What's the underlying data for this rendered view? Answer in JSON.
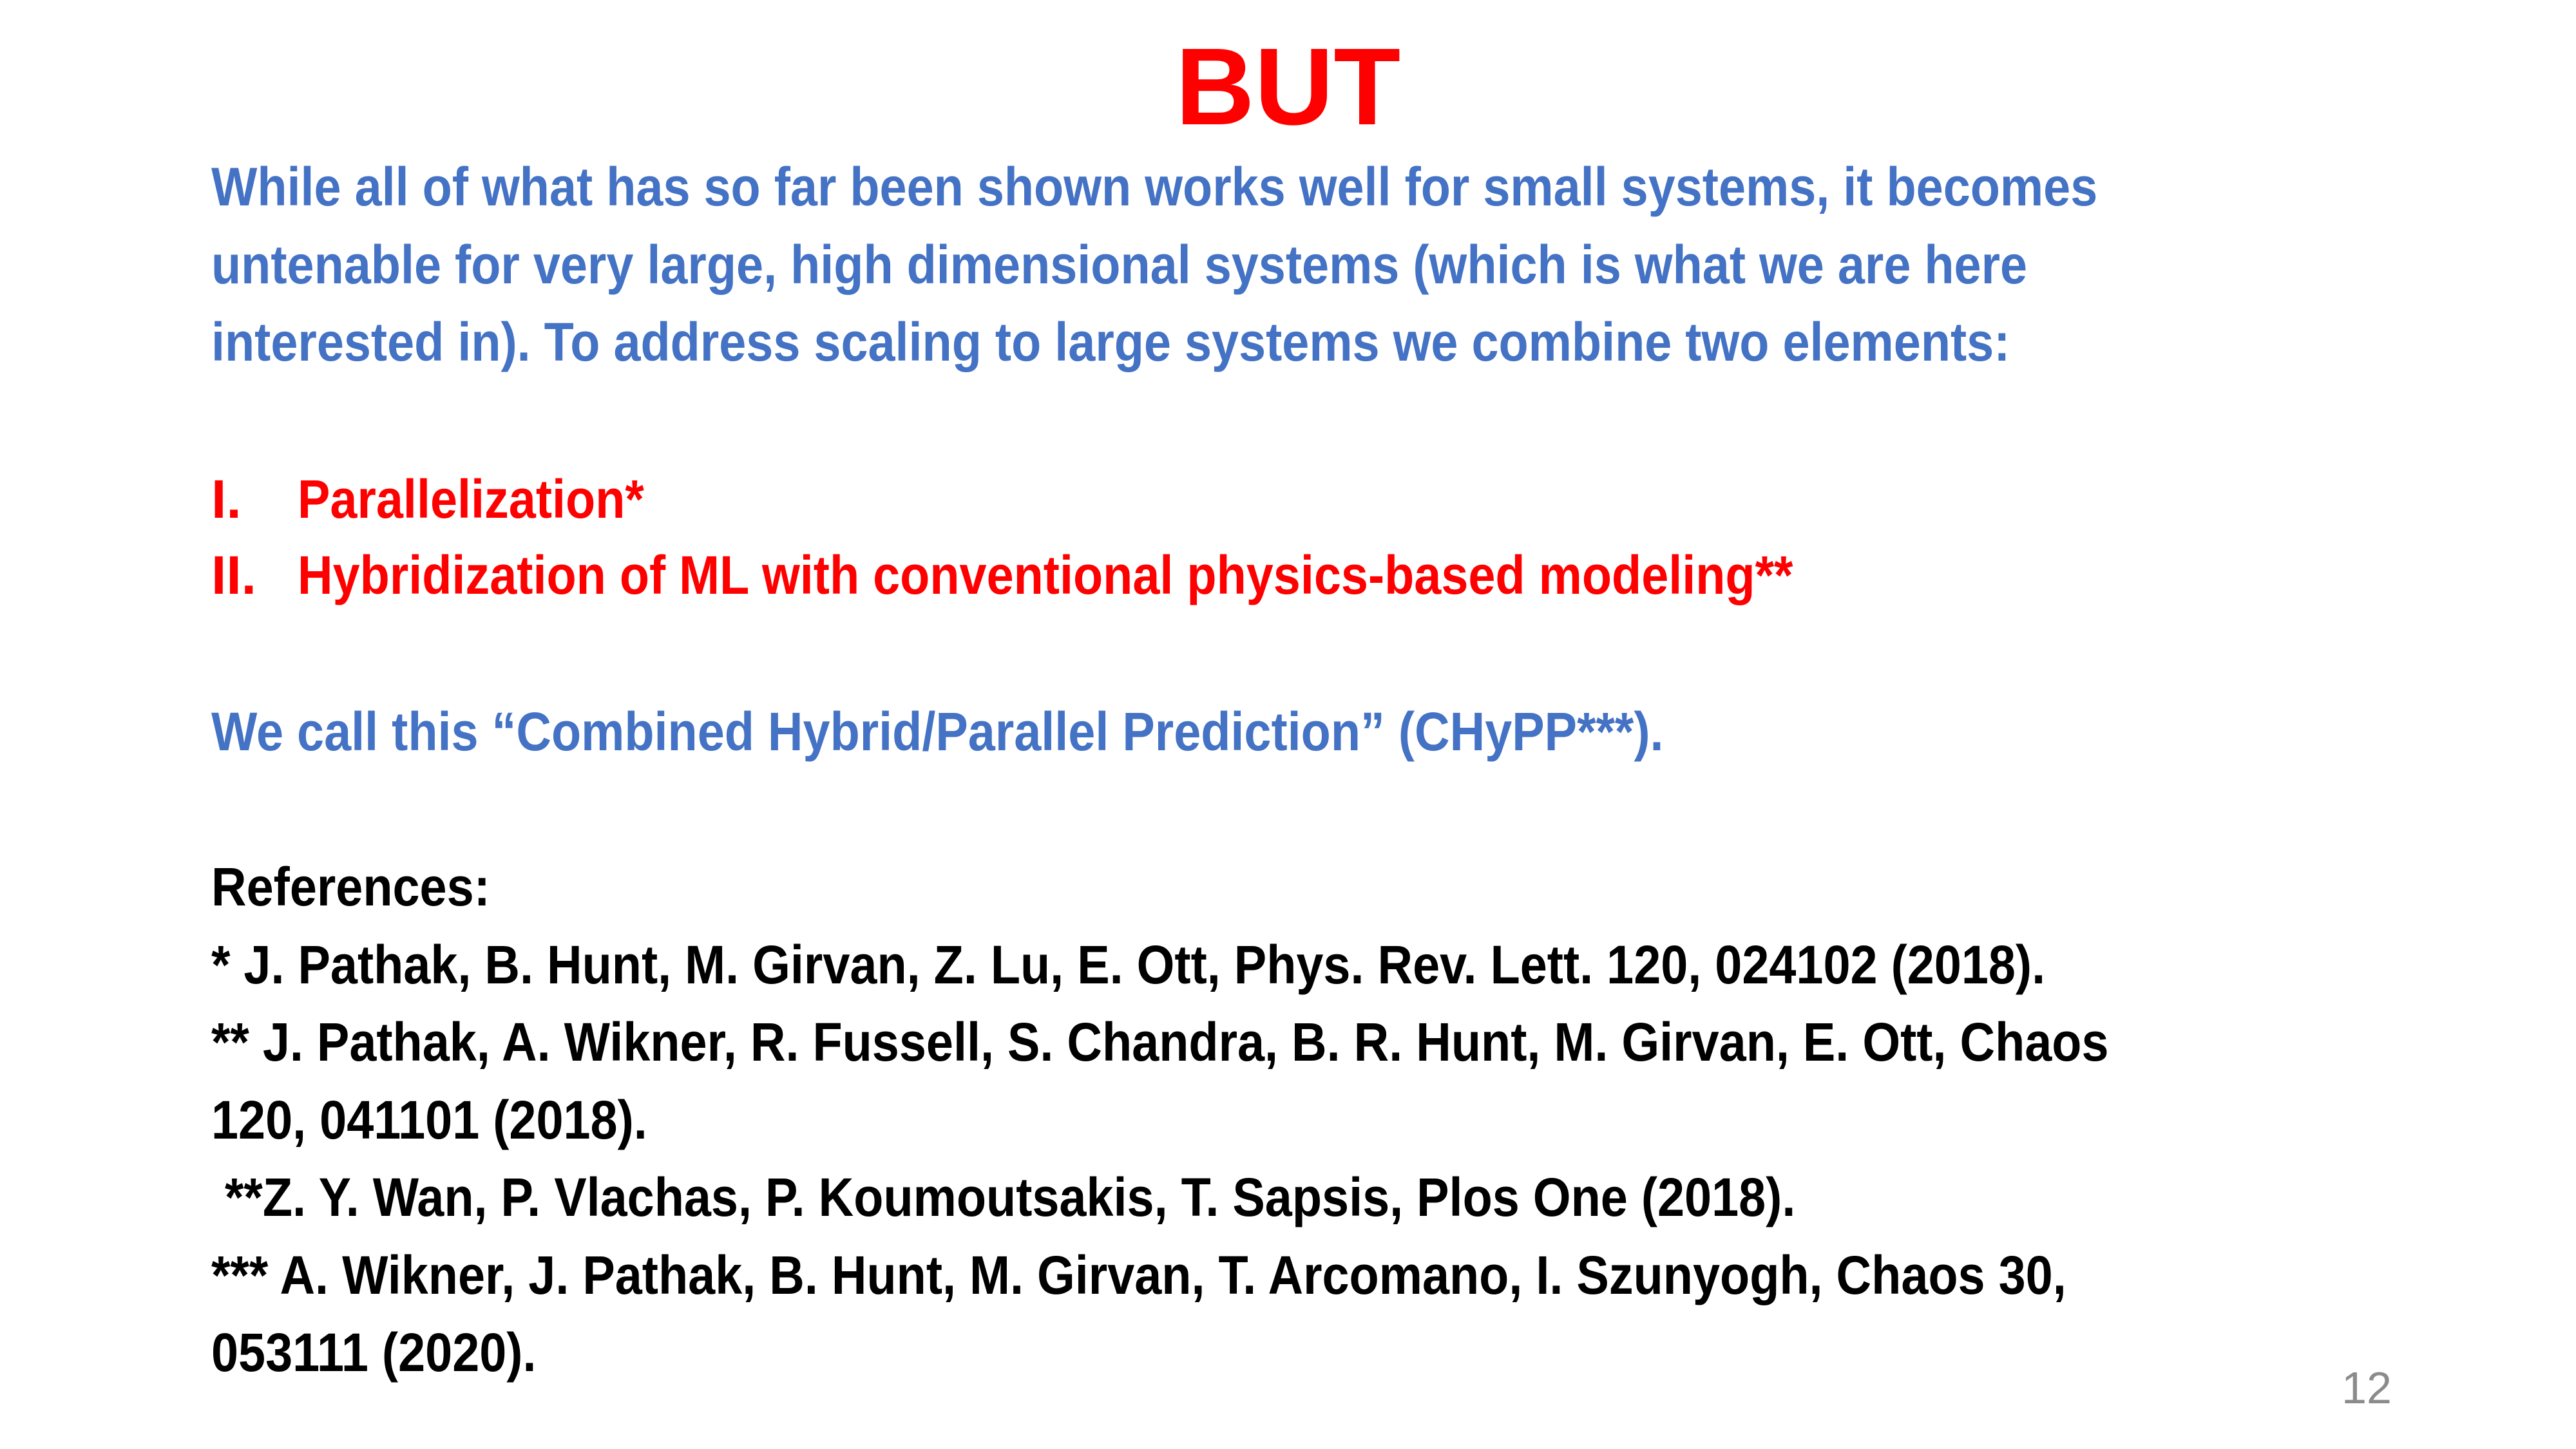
{
  "title": "BUT",
  "intro_lines": [
    "While all of what has so far been shown works well for small systems, it becomes",
    "untenable for very large, high dimensional systems (which is what we are here",
    "interested in). To address scaling to large systems we combine two elements:"
  ],
  "list": [
    {
      "marker": "I.",
      "text": "Parallelization*"
    },
    {
      "marker": "II.",
      "text": "Hybridization of ML with conventional physics-based modeling**"
    }
  ],
  "naming": "We call this “Combined Hybrid/Parallel Prediction” (CHyPP***).",
  "references": {
    "heading": "References:",
    "lines": [
      "* J. Pathak, B. Hunt, M. Girvan, Z. Lu, E. Ott, Phys. Rev. Lett. 120, 024102 (2018).",
      "** J. Pathak, A. Wikner, R. Fussell, S. Chandra, B. R. Hunt, M. Girvan, E. Ott, Chaos",
      "120, 041101 (2018).",
      " **Z. Y. Wan, P. Vlachas, P. Koumoutsakis, T. Sapsis, Plos One (2018).",
      "*** A. Wikner, J. Pathak, B. Hunt, M. Girvan, T. Arcomano, I. Szunyogh, Chaos 30,",
      "053111 (2020)."
    ]
  },
  "page_number": "12",
  "colors": {
    "blue": "#4472C4",
    "red": "#FF0000",
    "black": "#000000",
    "page_number": "#8B8B8B"
  }
}
